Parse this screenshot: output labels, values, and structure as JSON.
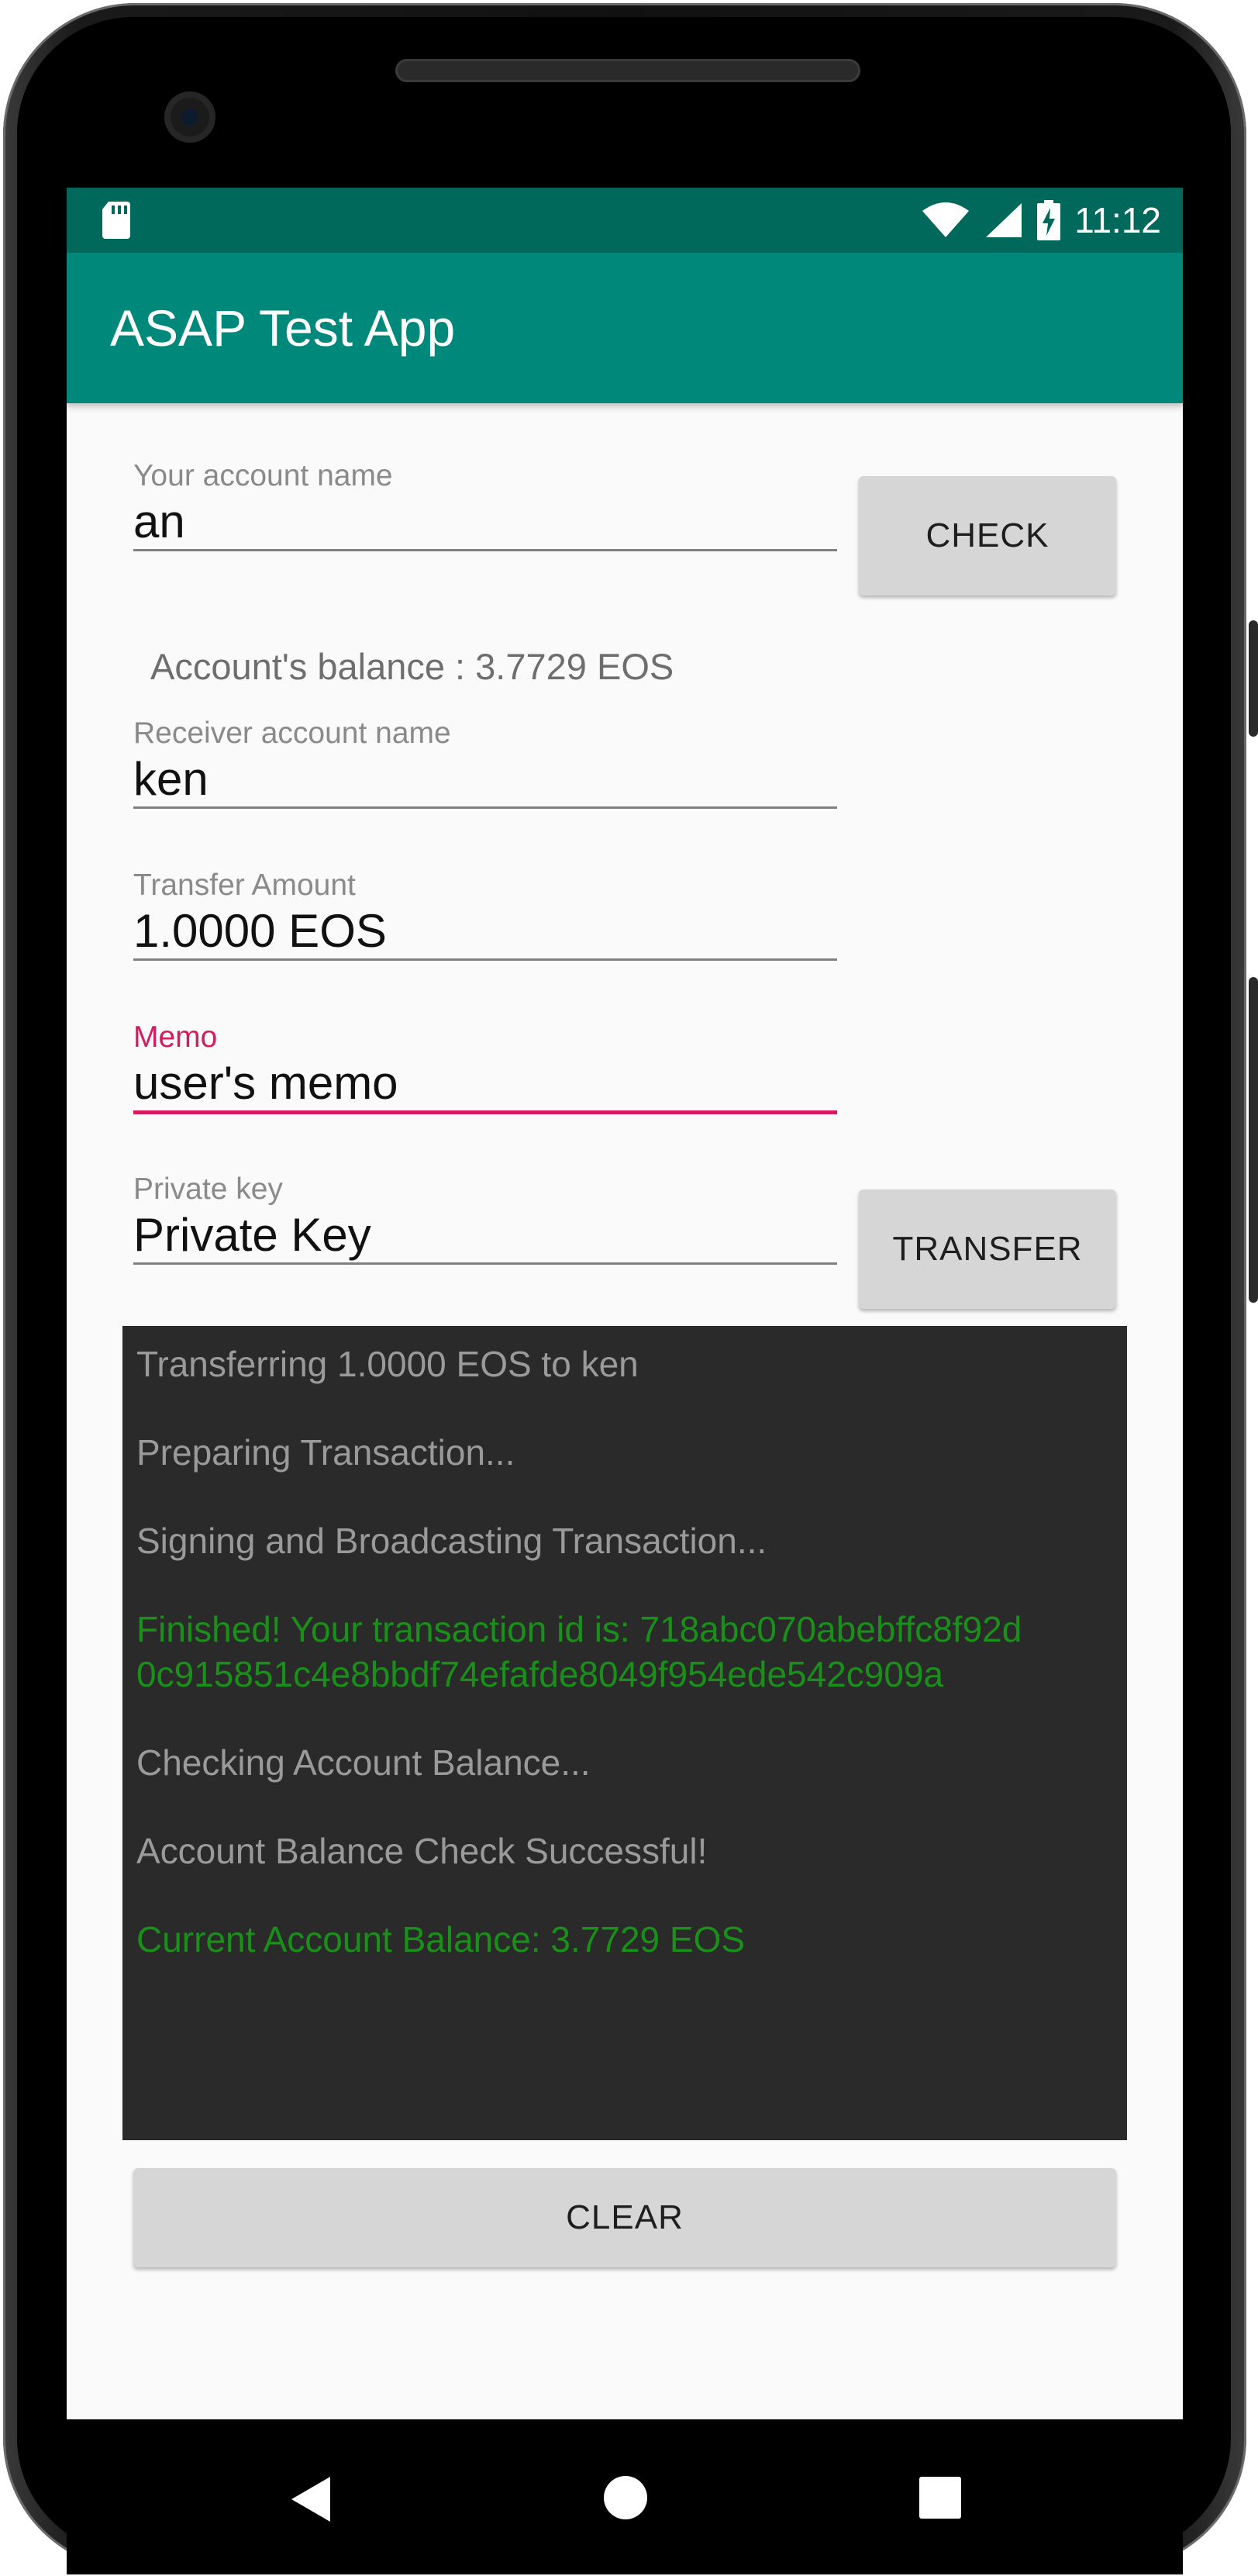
{
  "status_bar": {
    "time": "11:12",
    "icons": [
      "sd-card-icon",
      "wifi-icon",
      "cell-signal-icon",
      "battery-charging-icon"
    ]
  },
  "app_bar": {
    "title": "ASAP Test App"
  },
  "form": {
    "account_name": {
      "label": "Your account name",
      "value": "an"
    },
    "check_button": "CHECK",
    "balance_text": "Account's balance : 3.7729 EOS",
    "receiver": {
      "label": "Receiver account name",
      "value": "ken"
    },
    "amount": {
      "label": "Transfer Amount",
      "value": "1.0000 EOS"
    },
    "memo": {
      "label": "Memo",
      "value": "user's memo"
    },
    "private_key": {
      "label": "Private key",
      "value": "Private Key"
    },
    "transfer_button": "TRANSFER"
  },
  "console": {
    "lines": [
      {
        "text": "Transferring 1.0000 EOS to ken",
        "status": "info"
      },
      {
        "text": "Preparing Transaction...",
        "status": "info"
      },
      {
        "text": "Signing and Broadcasting Transaction...",
        "status": "info"
      },
      {
        "text": "Finished! Your transaction id is: 718abc070abebffc8f92d",
        "status": "ok"
      },
      {
        "text": "0c915851c4e8bbdf74efafde8049f954ede542c909a",
        "status": "ok"
      },
      {
        "text": "Checking Account Balance...",
        "status": "info"
      },
      {
        "text": "Account Balance Check Successful!",
        "status": "info"
      },
      {
        "text": "Current Account Balance: 3.7729 EOS",
        "status": "ok"
      }
    ]
  },
  "clear_button": "CLEAR",
  "colors": {
    "status_bar": "#00695c",
    "app_bar": "#00897b",
    "accent": "#d81b60",
    "success": "#1a8f1a",
    "console_bg": "#2a2a2a"
  }
}
